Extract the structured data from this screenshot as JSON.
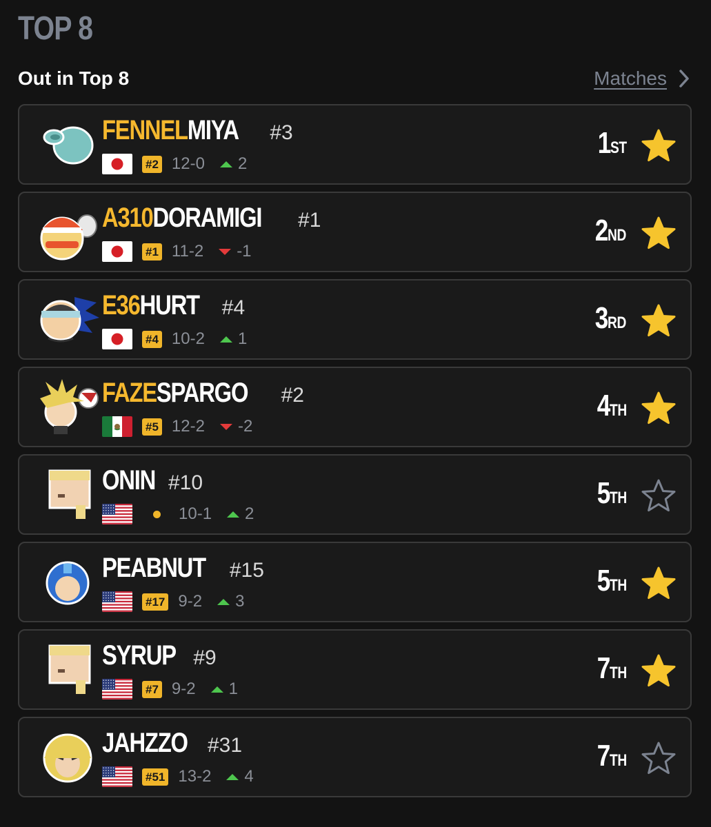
{
  "header": {
    "section_title": "TOP 8",
    "subtitle": "Out in Top 8",
    "matches_link": "Matches"
  },
  "colors": {
    "background": "#131313",
    "card_border": "#3a3a3a",
    "sponsor": "#f5b82e",
    "badge": "#f0b52a",
    "star_filled": "#f6c42d",
    "star_outline": "#7c8390",
    "delta_up": "#4ec64e",
    "delta_down": "#e33a3a",
    "muted_text": "#8b8f97"
  },
  "players": [
    {
      "sponsor": "FENNEL",
      "tag": "MIYA",
      "seed": "#3",
      "flag": "japan",
      "rank": "#2",
      "record": "12-0",
      "trend": "up",
      "delta": "2",
      "place_num": "1",
      "place_suffix": "ST",
      "starred": true,
      "avatar_icon": "blob-character-icon"
    },
    {
      "sponsor": "A310",
      "tag": "DORAMIGI",
      "seed": "#1",
      "flag": "japan",
      "rank": "#1",
      "record": "11-2",
      "trend": "down",
      "delta": "-1",
      "place_num": "2",
      "place_suffix": "ND",
      "starred": true,
      "avatar_icon": "min-min-character-icon"
    },
    {
      "sponsor": "E36",
      "tag": "HURT",
      "seed": "#4",
      "flag": "japan",
      "rank": "#4",
      "record": "10-2",
      "trend": "up",
      "delta": "1",
      "place_num": "3",
      "place_suffix": "RD",
      "starred": true,
      "avatar_icon": "snake-sonic-character-icon"
    },
    {
      "sponsor": "FAZE",
      "tag": "SPARGO",
      "seed": "#2",
      "flag": "mexico",
      "rank": "#5",
      "record": "12-2",
      "trend": "down",
      "delta": "-2",
      "place_num": "4",
      "place_suffix": "TH",
      "starred": true,
      "avatar_icon": "cloud-piranha-character-icon"
    },
    {
      "sponsor": "",
      "tag": "ONIN",
      "seed": "#10",
      "flag": "usa",
      "rank": "",
      "record": "10-1",
      "trend": "up",
      "delta": "2",
      "place_num": "5",
      "place_suffix": "TH",
      "starred": false,
      "avatar_icon": "steve-character-icon"
    },
    {
      "sponsor": "",
      "tag": "PEABNUT",
      "seed": "#15",
      "flag": "usa",
      "rank": "#17",
      "record": "9-2",
      "trend": "up",
      "delta": "3",
      "place_num": "5",
      "place_suffix": "TH",
      "starred": true,
      "avatar_icon": "mega-man-character-icon"
    },
    {
      "sponsor": "",
      "tag": "SYRUP",
      "seed": "#9",
      "flag": "usa",
      "rank": "#7",
      "record": "9-2",
      "trend": "up",
      "delta": "1",
      "place_num": "7",
      "place_suffix": "TH",
      "starred": true,
      "avatar_icon": "steve-character-icon"
    },
    {
      "sponsor": "",
      "tag": "JAHZZO",
      "seed": "#31",
      "flag": "usa",
      "rank": "#51",
      "record": "13-2",
      "trend": "up",
      "delta": "4",
      "place_num": "7",
      "place_suffix": "TH",
      "starred": false,
      "avatar_icon": "ken-character-icon"
    }
  ]
}
